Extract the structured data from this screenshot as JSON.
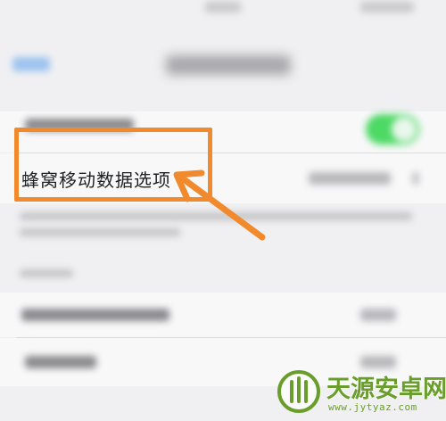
{
  "screen": {
    "cell": {
      "label": "蜂窝移动数据选项"
    }
  },
  "annotation": {
    "color": "#f08a2c"
  },
  "colors": {
    "toggle_on": "#4cd964",
    "link": "#9cc3ef",
    "watermark": "#6a9e2c"
  },
  "watermark": {
    "title": "天源安卓网",
    "url": "www.jytyaz.com"
  }
}
